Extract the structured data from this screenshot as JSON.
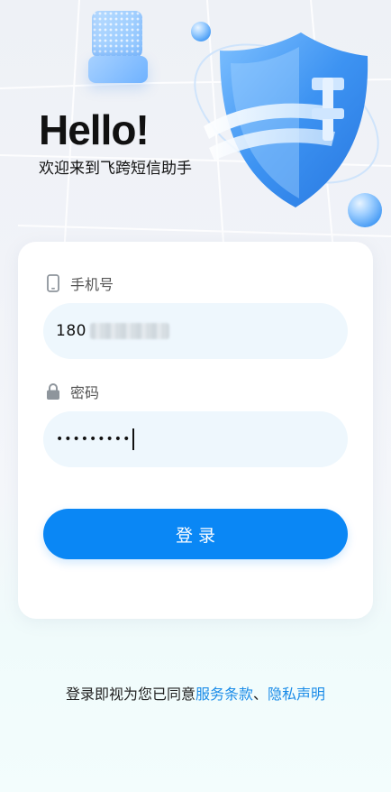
{
  "hero": {
    "title": "Hello!",
    "subtitle": "欢迎来到飞跨短信助手"
  },
  "form": {
    "phone": {
      "label": "手机号",
      "icon": "phone-icon",
      "value_visible_prefix": "180"
    },
    "password": {
      "label": "密码",
      "icon": "lock-icon",
      "value_masked": "•••••••••"
    },
    "login_button": "登录"
  },
  "agreement": {
    "prefix": "登录即视为您已同意",
    "terms_link": "服务条款",
    "separator": "、",
    "privacy_link": "隐私声明"
  },
  "colors": {
    "accent": "#0a87f5",
    "link": "#1b8ce8",
    "input_bg": "#eef7fd"
  }
}
